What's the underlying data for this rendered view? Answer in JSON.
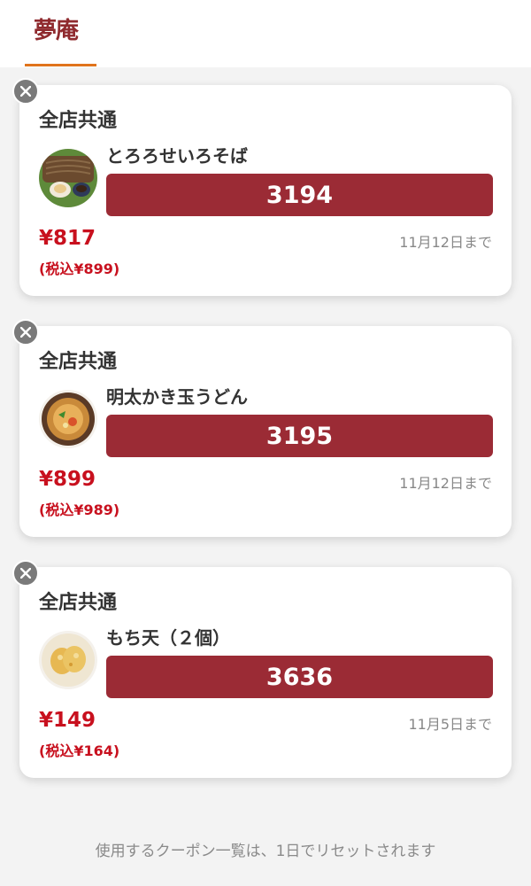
{
  "header": {
    "logo_text": "夢庵",
    "accent_color": "#e0741c",
    "brand_color": "#8f2a2e"
  },
  "coupons": [
    {
      "scope": "全店共通",
      "item": "とろろせいろそば",
      "code": "3194",
      "price": "¥817",
      "tax_price": "(税込¥899)",
      "expiry": "11月12日まで",
      "image": "soba-dish-icon"
    },
    {
      "scope": "全店共通",
      "item": "明太かき玉うどん",
      "code": "3195",
      "price": "¥899",
      "tax_price": "(税込¥989)",
      "expiry": "11月12日まで",
      "image": "udon-bowl-icon"
    },
    {
      "scope": "全店共通",
      "item": "もち天（２個）",
      "code": "3636",
      "price": "¥149",
      "tax_price": "(税込¥164)",
      "expiry": "11月5日まで",
      "image": "mochi-tempura-icon"
    }
  ],
  "colors": {
    "code_button": "#9b2b35",
    "price_red": "#c8101e"
  },
  "footer": {
    "note": "使用するクーポン一覧は、1日でリセットされます"
  }
}
